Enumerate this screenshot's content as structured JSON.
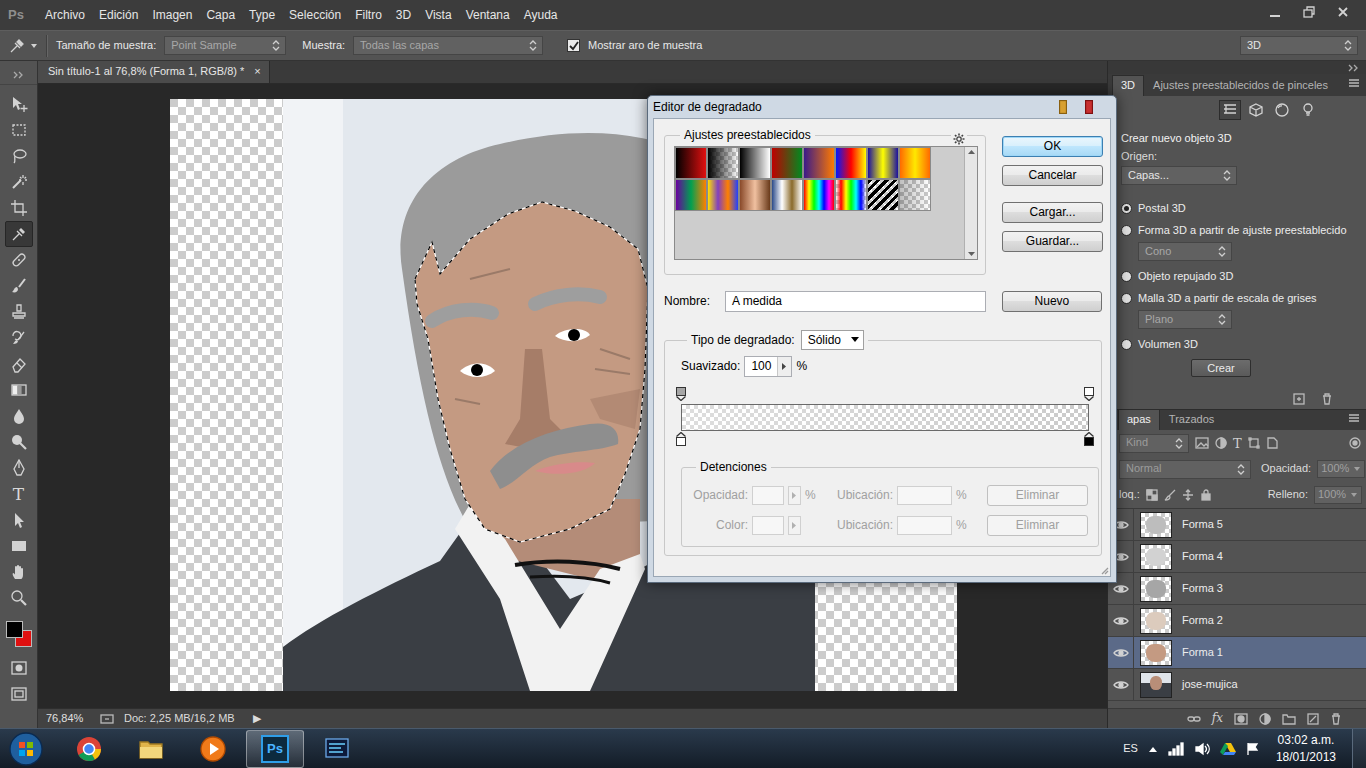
{
  "app": {
    "logo": "Ps"
  },
  "menu": [
    "Archivo",
    "Edición",
    "Imagen",
    "Capa",
    "Type",
    "Selección",
    "Filtro",
    "3D",
    "Vista",
    "Ventana",
    "Ayuda"
  ],
  "options_bar": {
    "sample_size_label": "Tamaño de muestra:",
    "sample_size": "Point Sample",
    "sample_label": "Muestra:",
    "sample": "Todas las capas",
    "ring_label": "Mostrar aro de muestra",
    "ring_checked": true,
    "workspace": "3D"
  },
  "document": {
    "title": "Sin título-1 al 76,8% (Forma 1, RGB/8) *",
    "close": "×"
  },
  "tools": [
    {
      "selected": false
    },
    {
      "selected": false
    },
    {
      "selected": false
    },
    {
      "selected": false
    },
    {
      "selected": false
    },
    {
      "selected": true
    },
    {
      "selected": false
    },
    {
      "selected": false
    },
    {
      "selected": false
    },
    {
      "selected": false
    },
    {
      "selected": false
    },
    {
      "selected": false
    },
    {
      "selected": false
    },
    {
      "selected": false
    },
    {
      "selected": false
    },
    {
      "selected": false,
      "glyph": "T"
    },
    {
      "selected": false
    },
    {
      "selected": false
    },
    {
      "selected": false
    },
    {
      "selected": false
    },
    {
      "selected": false
    },
    {
      "selected": false
    }
  ],
  "colors": {
    "foreground": "#000000",
    "background": "#e01010"
  },
  "status_bar": {
    "zoom": "76,84%",
    "doc": "Doc: 2,25 MB/16,2 MB",
    "arrow": "▶"
  },
  "gradient_editor": {
    "title": "Editor de degradado",
    "presets": {
      "label": "Ajustes preestablecidos",
      "items": [
        {
          "kind": "linear",
          "colors": [
            "#000000",
            "#e01010"
          ]
        },
        {
          "kind": "linear",
          "colors": [
            "#000000",
            "#00000000"
          ]
        },
        {
          "kind": "linear",
          "colors": [
            "#000000",
            "#ffffff"
          ]
        },
        {
          "kind": "linear",
          "colors": [
            "#c00000",
            "#008a20"
          ]
        },
        {
          "kind": "linear",
          "colors": [
            "#3a1a8a",
            "#ff7a00"
          ]
        },
        {
          "kind": "linear",
          "colors": [
            "#0018ff",
            "#ff0000",
            "#ffff00"
          ]
        },
        {
          "kind": "linear",
          "colors": [
            "#1a10a0",
            "#ffff00",
            "#1a10a0"
          ]
        },
        {
          "kind": "linear",
          "colors": [
            "#ff6a00",
            "#ffe800",
            "#ff6a00"
          ]
        },
        {
          "kind": "linear",
          "colors": [
            "#6a00a0",
            "#00a050",
            "#ff8000"
          ]
        },
        {
          "kind": "linear",
          "colors": [
            "#ffe000",
            "#8040c0",
            "#ff8000",
            "#2040ff"
          ]
        },
        {
          "kind": "linear",
          "colors": [
            "#8a4a2a",
            "#f0c0a0",
            "#6a3a1a"
          ]
        },
        {
          "kind": "linear",
          "colors": [
            "#2a4a8a",
            "#ffffff",
            "#8a6a2a",
            "#ffffff"
          ]
        },
        {
          "kind": "linear",
          "colors": [
            "#ff0000",
            "#ffff00",
            "#00ff00",
            "#00ffff",
            "#0000ff",
            "#ff00ff",
            "#ff0000"
          ]
        },
        {
          "kind": "linear",
          "colors": [
            "#ff000000",
            "#ff0000",
            "#ffff00",
            "#00ff00",
            "#00ffff",
            "#0000ff",
            "#ff00ff00"
          ]
        },
        {
          "kind": "stripes",
          "colors": [
            "#000000",
            "#ffffff00"
          ]
        },
        {
          "kind": "linear",
          "colors": [
            "#00000040",
            "#00000000"
          ]
        }
      ]
    },
    "buttons": [
      {
        "label": "OK",
        "default": true
      },
      {
        "label": "Cancelar",
        "default": false
      },
      {
        "label": "Cargar...",
        "default": false
      },
      {
        "label": "Guardar...",
        "default": false
      }
    ],
    "name": {
      "label": "Nombre:",
      "value": "A medida",
      "button": "Nuevo"
    },
    "type": {
      "label": "Tipo de degradado:",
      "value": "Sólido"
    },
    "smoothness": {
      "label": "Suavizado:",
      "value": "100",
      "unit": "%"
    },
    "opacity_stops": [
      {
        "level": 0,
        "opacity": 0.35
      },
      {
        "level": 1,
        "opacity": 0
      }
    ],
    "color_stops": [
      {
        "level": 0,
        "color": "#ffffff"
      },
      {
        "level": 1,
        "color": "#000000"
      }
    ],
    "stops": {
      "label": "Detenciones",
      "rows": [
        {
          "kind": "stepper",
          "field_label": "Opacidad:",
          "unit": "%",
          "location_label": "Ubicación:",
          "location_unit": "%",
          "button": "Eliminar",
          "disabled": true
        },
        {
          "kind": "swatch",
          "field_label": "Color:",
          "location_label": "Ubicación:",
          "location_unit": "%",
          "button": "Eliminar",
          "disabled": true
        }
      ]
    }
  },
  "panel_3d": {
    "tabs": [
      {
        "label": "3D",
        "selected": true
      },
      {
        "label": "Ajustes preestablecidos de pinceles",
        "selected": false
      }
    ],
    "views": [
      {
        "selected": true
      },
      {
        "selected": false
      },
      {
        "selected": false
      },
      {
        "selected": false
      }
    ],
    "heading": "Crear nuevo objeto 3D",
    "source_label": "Origen:",
    "source": "Capas...",
    "options": [
      {
        "label": "Postal 3D",
        "selected": true
      },
      {
        "label": "Forma 3D a partir de ajuste preestablecido",
        "selected": false,
        "dropdown": "Cono",
        "dropdown_disabled": true
      },
      {
        "label": "Objeto repujado 3D",
        "selected": false
      },
      {
        "label": "Malla 3D a partir de escala de grises",
        "selected": false,
        "dropdown": "Plano",
        "dropdown_disabled": true
      },
      {
        "label": "Volumen 3D",
        "selected": false
      }
    ],
    "create": "Crear"
  },
  "layers_panel": {
    "tabs": [
      {
        "label": "apas",
        "selected": true
      },
      {
        "label": "Trazados",
        "selected": false
      }
    ],
    "filter": "Kind",
    "filter_glyph": "T",
    "blend_mode": "Normal",
    "opacity_label": "Opacidad:",
    "opacity": "100%",
    "lock_label": "loq.:",
    "fill_label": "Relleno:",
    "fill": "100%",
    "controls_disabled": true,
    "layers": [
      {
        "name": "Forma 5",
        "visible": true,
        "selected": false,
        "kind": "shape",
        "color": "#bdbdbd"
      },
      {
        "name": "Forma 4",
        "visible": true,
        "selected": false,
        "kind": "shape",
        "color": "#d2d2d2"
      },
      {
        "name": "Forma 3",
        "visible": true,
        "selected": false,
        "kind": "shape",
        "color": "#a6a6a6"
      },
      {
        "name": "Forma 2",
        "visible": true,
        "selected": false,
        "kind": "shape",
        "color": "#dccbbd"
      },
      {
        "name": "Forma 1",
        "visible": true,
        "selected": true,
        "kind": "shape",
        "color": "#c49a82"
      },
      {
        "name": "jose-mujica",
        "visible": true,
        "selected": false,
        "kind": "photo",
        "color": "#b88e78"
      }
    ],
    "fx_glyph": "fx"
  },
  "taskbar": {
    "apps": [
      {
        "selected": false
      },
      {
        "selected": false
      },
      {
        "selected": false
      },
      {
        "selected": true,
        "label": "Ps"
      },
      {
        "selected": false
      }
    ],
    "language": "ES",
    "time": "03:02 a.m.",
    "date": "18/01/2013"
  }
}
